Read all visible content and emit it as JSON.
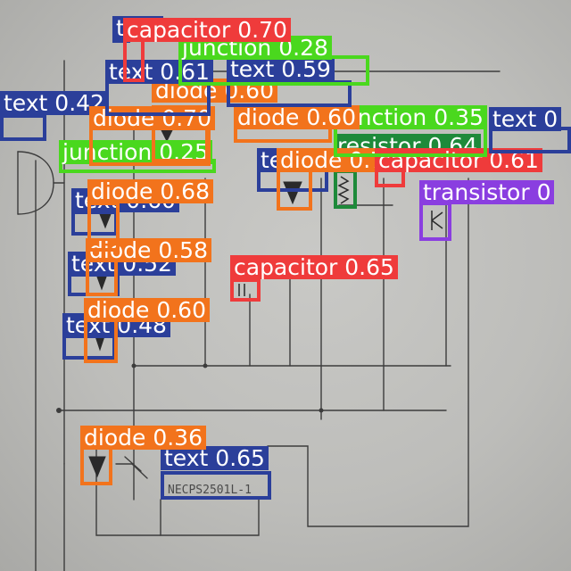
{
  "colors": {
    "text": "#2b3f9a",
    "capacitor": "#ef3b3b",
    "junction": "#4ad81e",
    "diode": "#f2731c",
    "resistor": "#1e8a3a",
    "transistor": "#8a3ee0"
  },
  "handwritten_texts": [
    "NECPS2501L-1"
  ],
  "detections": [
    {
      "cls": "text",
      "label": "text",
      "score": "0.65",
      "color_key": "text"
    },
    {
      "cls": "diode",
      "label": "diode",
      "score": "0.36",
      "color_key": "diode"
    },
    {
      "cls": "text",
      "label": "text",
      "score": "0.48",
      "color_key": "text"
    },
    {
      "cls": "diode",
      "label": "diode",
      "score": "0.60",
      "color_key": "diode"
    },
    {
      "cls": "text",
      "label": "text",
      "score": "0.52",
      "color_key": "text"
    },
    {
      "cls": "diode",
      "label": "diode",
      "score": "0.58",
      "color_key": "diode"
    },
    {
      "cls": "text",
      "label": "text",
      "score": "0.60",
      "color_key": "text"
    },
    {
      "cls": "diode",
      "label": "diode",
      "score": "0.68",
      "color_key": "diode"
    },
    {
      "cls": "capacitor",
      "label": "capacitor",
      "score": "0.65",
      "color_key": "capacitor"
    },
    {
      "cls": "transistor",
      "label": "transistor",
      "score": "0",
      "color_key": "transistor"
    },
    {
      "cls": "text",
      "label": "text",
      "score": "0.60",
      "color_key": "text"
    },
    {
      "cls": "resistor",
      "label": "resistor",
      "score": "0.64",
      "color_key": "resistor"
    },
    {
      "cls": "diode",
      "label": "diode",
      "score": "0.71",
      "color_key": "diode"
    },
    {
      "cls": "capacitor",
      "label": "capacitor",
      "score": "0.61",
      "color_key": "capacitor"
    },
    {
      "cls": "junction",
      "label": "junction",
      "score": "0.35",
      "color_key": "junction"
    },
    {
      "cls": "text",
      "label": "text",
      "score": "0",
      "color_key": "text"
    },
    {
      "cls": "text",
      "label": "text",
      "score": "0.42",
      "color_key": "text"
    },
    {
      "cls": "junction",
      "label": "junction",
      "score": "0.25",
      "color_key": "junction"
    },
    {
      "cls": "diode",
      "label": "diode",
      "score": "0.60",
      "color_key": "diode"
    },
    {
      "cls": "diode",
      "label": "diode",
      "score": "0.70",
      "color_key": "diode"
    },
    {
      "cls": "diode",
      "label": "diode",
      "score": "0.60",
      "color_key": "diode"
    },
    {
      "cls": "text",
      "label": "text",
      "score": "0.59",
      "color_key": "text"
    },
    {
      "cls": "text",
      "label": "text",
      "score": "0.61",
      "color_key": "text"
    },
    {
      "cls": "junction",
      "label": "junction",
      "score": "0.28",
      "color_key": "junction"
    },
    {
      "cls": "text",
      "label": "text",
      "score": "",
      "color_key": "text"
    },
    {
      "cls": "capacitor",
      "label": "capacitor",
      "score": "0.70",
      "color_key": "capacitor"
    }
  ]
}
